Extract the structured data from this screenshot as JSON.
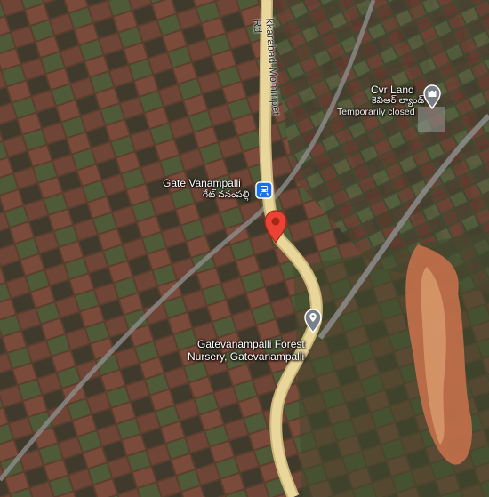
{
  "map": {
    "road_label": "kkarabad-Mominpet Rd",
    "places": [
      {
        "id": "gate-vanampalli",
        "name": "Gate Vanampalli",
        "local_name": "గేట్ వనంపల్లి",
        "status": "",
        "icon": "train-station-icon"
      },
      {
        "id": "cvr-land",
        "name": "Cvr Land",
        "local_name": "కెవిఆర్ ల్యాండ్",
        "status": "Temporarily closed",
        "icon": "castle-icon"
      },
      {
        "id": "forest-nursery",
        "name": "Gatevanampalli Forest",
        "name_line2": "Nursery, Gatevanampalli",
        "icon": "map-pin-icon"
      }
    ],
    "selected_marker": {
      "icon": "red-location-pin-icon",
      "color": "#ea4335"
    },
    "colors": {
      "road_fill": "#e9d69b",
      "railway": "#8c8c8c",
      "transit_badge": "#1a73e8",
      "poi_pin": "#7a8088"
    }
  }
}
